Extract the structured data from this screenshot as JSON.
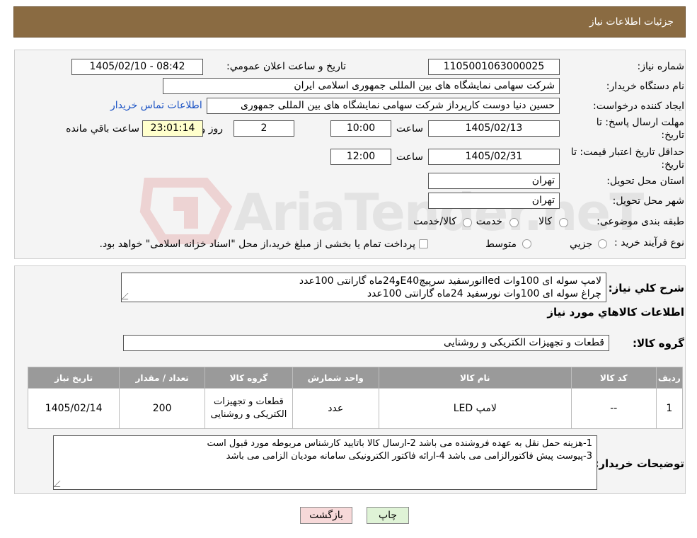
{
  "header": {
    "title": "جزئیات اطلاعات نیاز"
  },
  "form": {
    "need_number_label": "شماره نیاز:",
    "need_number": "1105001063000025",
    "announce_label": "تاريخ و ساعت اعلان عمومي:",
    "announce_value": "1405/02/10 - 08:42",
    "buyer_org_label": "نام دستگاه خريدار:",
    "buyer_org": "شرکت سهامی نمایشگاه های بین المللی جمهوری اسلامی ایران",
    "requester_label": "ايجاد کننده درخواست:",
    "requester": "حسین دنیا دوست کارپرداز شرکت سهامی نمایشگاه های بین المللی جمهوری",
    "contact_link": "اطلاعات تماس خريدار",
    "deadline_label_1": "مهلت ارسال پاسخ: تا",
    "deadline_label_2": "تاريخ:",
    "deadline_date": "1405/02/13",
    "time_word": "ساعت",
    "deadline_time": "10:00",
    "days_value": "2",
    "days_word": "روز و",
    "remaining_time": "23:01:14",
    "remaining_word": "ساعت باقي مانده",
    "validity_label_1": "حداقل تاريخ اعتبار قيمت: تا",
    "validity_label_2": "تاريخ:",
    "validity_date": "1405/02/31",
    "validity_time": "12:00",
    "province_label": "استان محل تحويل:",
    "province": "تهران",
    "city_label": "شهر محل تحويل:",
    "city": "تهران",
    "category_label": "طبقه بندی موضوعی:",
    "category_options": [
      "کالا",
      "خدمت",
      "کالا/خدمت"
    ],
    "process_label": "نوع فرآيند خريد :",
    "process_options": [
      "جزيي",
      "متوسط"
    ],
    "payment_note": "پرداخت تمام يا بخشی از مبلغ خريد،از محل \"اسناد خزانه اسلامی\" خواهد بود."
  },
  "details": {
    "summary_label": "شرح کلي نياز:",
    "summary_lines": [
      "لامپ سوله ای 100وات ledانورسفید سرپیچE40و24ماه گارانتی 100عدد",
      "چراغ سوله ای 100وات نورسفید 24ماه گارانتی 100عدد"
    ],
    "goods_info_title": "اطلاعات کالاهاي مورد نياز",
    "goods_group_label": "گروه کالا:",
    "goods_group": "قطعات و تجهیزات الکتریکی و روشنایی",
    "table_headers": [
      "رديف",
      "کد کالا",
      "نام کالا",
      "واحد شمارش",
      "گروه کالا",
      "تعداد / مقدار",
      "تاريخ نياز"
    ],
    "table_rows": [
      [
        "1",
        "--",
        "لامپ LED",
        "عدد",
        "قطعات و تجهیزات الکتریکی و روشنایی",
        "200",
        "1405/02/14"
      ]
    ],
    "buyer_notes_label": "توضيحات خريدار:",
    "buyer_notes_lines": [
      "1-هزینه حمل نقل به عهده فروشنده می باشد 2-ارسال کالا باتایید کارشناس مربوطه مورد قبول است",
      "3-پیوست پیش فاکتورالزامی می باشد 4-ارائه فاکتور الکترونیکی سامانه مودیان الزامی می باشد"
    ]
  },
  "buttons": {
    "print": "چاپ",
    "back": "بازگشت"
  },
  "watermark_text": "AriaTender.neT",
  "colors": {
    "header_bg": "#8a6b42",
    "table_header_bg": "#9a9a9a",
    "back_button_bg": "#f7d9d9",
    "print_button_bg": "#dff3d6",
    "yellow_box": "#ffffcc"
  }
}
